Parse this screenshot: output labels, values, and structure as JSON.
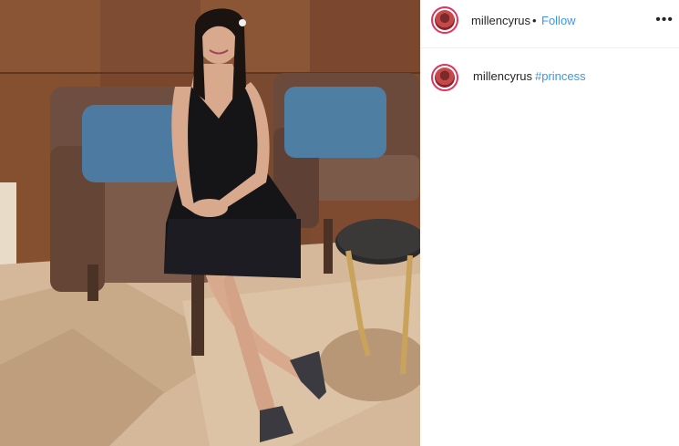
{
  "post": {
    "author": {
      "username": "millencyrus",
      "separator": "•",
      "follow_label": "Follow",
      "more_icon": "more-options-icon"
    },
    "caption": {
      "username": "millencyrus",
      "hashtag": "#princess"
    },
    "photo": {
      "description_icon": "photo"
    }
  },
  "colors": {
    "follow_blue": "#3897f0",
    "hashtag_blue": "#003569",
    "story_ring": "#e0335e"
  }
}
